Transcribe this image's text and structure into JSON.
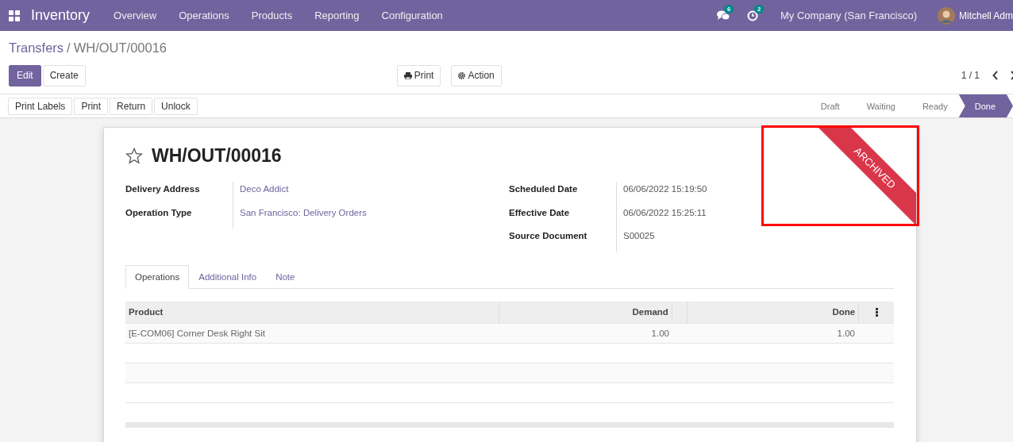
{
  "navbar": {
    "app_name": "Inventory",
    "menu": [
      "Overview",
      "Operations",
      "Products",
      "Reporting",
      "Configuration"
    ],
    "messages_count": "6",
    "activities_count": "2",
    "company": "My Company (San Francisco)",
    "user": "Mitchell Adm"
  },
  "breadcrumb": {
    "parent": "Transfers",
    "separator": "/",
    "current": "WH/OUT/00016"
  },
  "main_buttons": [
    {
      "label": "Edit",
      "primary": true
    },
    {
      "label": "Create",
      "primary": false
    }
  ],
  "center_buttons": [
    "Print",
    "Action"
  ],
  "pager": "1 / 1",
  "action_buttons": [
    "Print Labels",
    "Print",
    "Return",
    "Unlock"
  ],
  "stages": [
    {
      "label": "Draft",
      "selected": false
    },
    {
      "label": "Waiting",
      "selected": false
    },
    {
      "label": "Ready",
      "selected": false
    },
    {
      "label": "Done",
      "selected": true
    }
  ],
  "record": {
    "starred": false,
    "title": "WH/OUT/00016",
    "ribbon": "ARCHIVED",
    "highlighted": true,
    "left_fields": [
      {
        "label": "Delivery Address",
        "value": "Deco Addict",
        "link": true
      },
      {
        "label": "Operation Type",
        "value": "San Francisco: Delivery Orders",
        "link": true
      }
    ],
    "right_fields": [
      {
        "label": "Scheduled Date",
        "value": "06/06/2022 15:19:50",
        "link": false
      },
      {
        "label": "Effective Date",
        "value": "06/06/2022 15:25:11",
        "link": false
      },
      {
        "label": "Source Document",
        "value": "S00025",
        "link": false
      }
    ]
  },
  "tabs": [
    {
      "label": "Operations",
      "selected": true
    },
    {
      "label": "Additional Info",
      "selected": false
    },
    {
      "label": "Note",
      "selected": false
    }
  ],
  "table": {
    "columns": [
      "Product",
      "Demand",
      "Done"
    ],
    "rows": [
      {
        "product": "[E-COM06] Corner Desk Right Sit",
        "demand": "1.00",
        "done": "1.00"
      }
    ]
  }
}
